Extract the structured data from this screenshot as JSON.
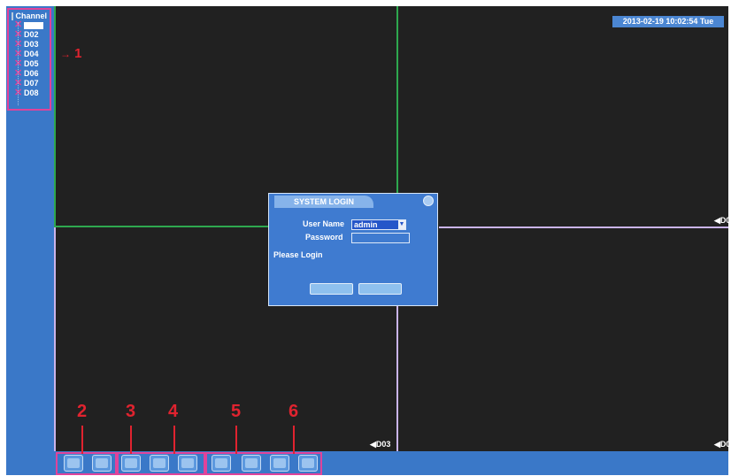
{
  "sidebar": {
    "channel_title": "Channel",
    "channels": [
      "",
      "D02",
      "D03",
      "D04",
      "D05",
      "D06",
      "D07",
      "D08"
    ]
  },
  "annotations": {
    "one": "1",
    "two": "2",
    "three": "3",
    "four": "4",
    "five": "5",
    "six": "6"
  },
  "datetime": "2013-02-19 10:02:54 Tue",
  "camera_labels": {
    "top_right": "D0",
    "bottom_left": "D03",
    "bottom_right": "D0"
  },
  "login_dialog": {
    "title": "SYSTEM LOGIN",
    "user_name_label": "User Name",
    "user_name_value": "admin",
    "password_label": "Password",
    "status": "Please Login"
  },
  "colors": {
    "accent_pink": "#e0439a",
    "annotation_red": "#e0232f",
    "toolbar_blue": "#3a78c8"
  },
  "icons": [
    "channel-checkbox-icon",
    "channel-off-icon",
    "dropdown-arrow-icon",
    "close-icon"
  ]
}
